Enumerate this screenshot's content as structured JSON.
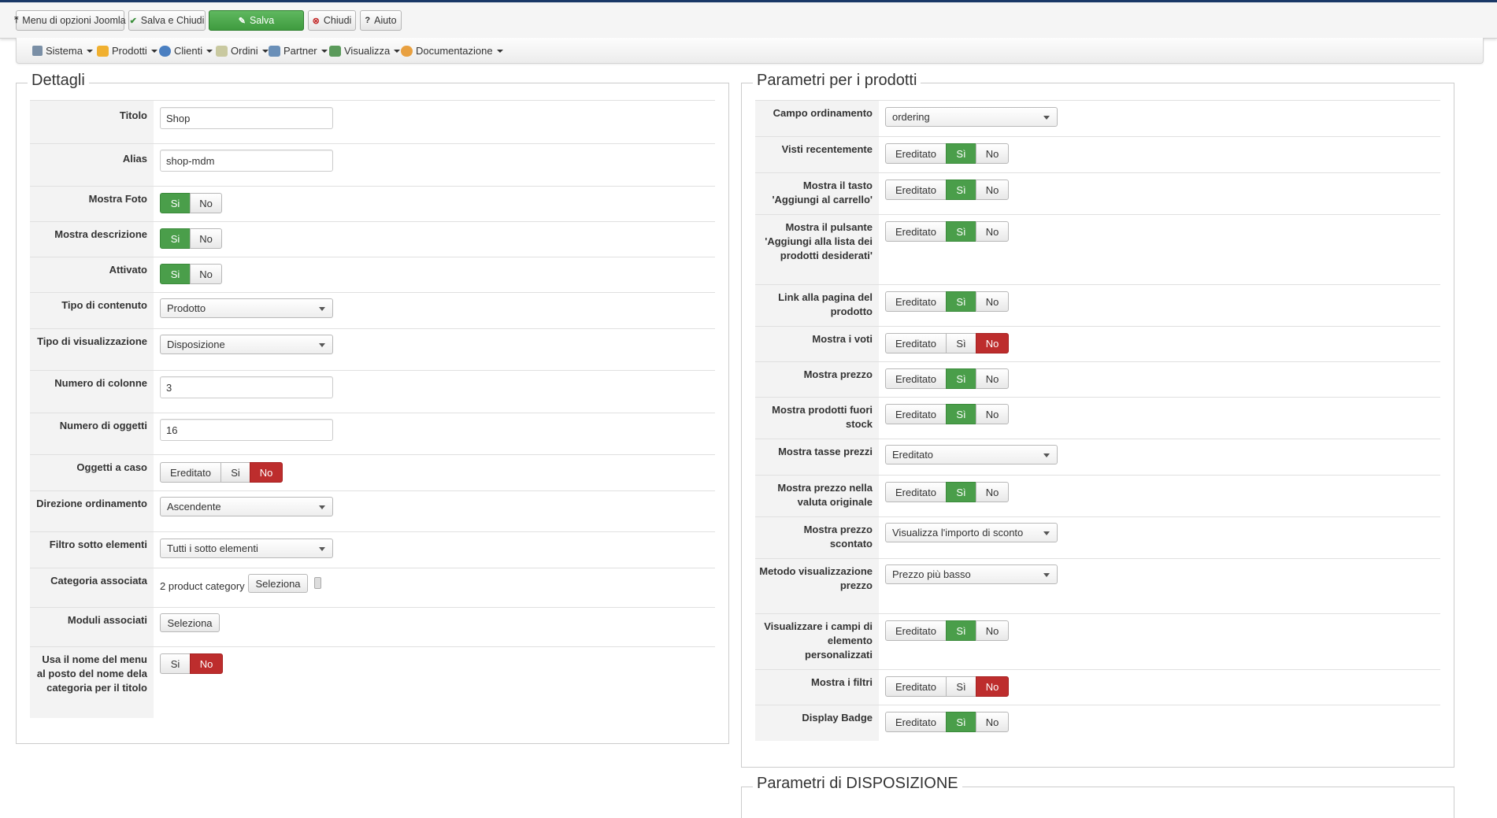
{
  "toolbar": {
    "menu_options": "Menu di opzioni Joomla",
    "save_close": "Salva e Chiudi",
    "save": "Salva",
    "close": "Chiudi",
    "help": "Aiuto"
  },
  "nav": {
    "sistema": "Sistema",
    "prodotti": "Prodotti",
    "clienti": "Clienti",
    "ordini": "Ordini",
    "partner": "Partner",
    "visualizza": "Visualizza",
    "documentazione": "Documentazione"
  },
  "common": {
    "ereditato": "Ereditato",
    "si": "Sì",
    "si_plain": "Si",
    "no": "No"
  },
  "dettagli": {
    "legend": "Dettagli",
    "titolo_label": "Titolo",
    "titolo_value": "Shop",
    "alias_label": "Alias",
    "alias_value": "shop-mdm",
    "mostra_foto_label": "Mostra Foto",
    "mostra_desc_label": "Mostra descrizione",
    "attivato_label": "Attivato",
    "tipo_contenuto_label": "Tipo di contenuto",
    "tipo_contenuto_value": "Prodotto",
    "tipo_vis_label": "Tipo di visualizzazione",
    "tipo_vis_value": "Disposizione",
    "num_colonne_label": "Numero di colonne",
    "num_colonne_value": "3",
    "num_oggetti_label": "Numero di oggetti",
    "num_oggetti_value": "16",
    "oggetti_caso_label": "Oggetti a caso",
    "direzione_label": "Direzione ordinamento",
    "direzione_value": "Ascendente",
    "filtro_label": "Filtro sotto elementi",
    "filtro_value": "Tutti i sotto elementi",
    "categoria_label": "Categoria associata",
    "categoria_value": "2 product category",
    "seleziona": "Seleziona",
    "moduli_label": "Moduli associati",
    "usa_nome_label": "Usa il nome del menu al posto del nome dela categoria per il titolo"
  },
  "parametri": {
    "legend": "Parametri per i prodotti",
    "campo_ord_label": "Campo ordinamento",
    "campo_ord_value": "ordering",
    "visti_label": "Visti recentemente",
    "tasto_carrello_label": "Mostra il tasto 'Aggiungi al carrello'",
    "pulsante_lista_label": "Mostra il pulsante 'Aggiungi alla lista dei prodotti desiderati'",
    "link_pagina_label": "Link alla pagina del prodotto",
    "voti_label": "Mostra i voti",
    "prezzo_label": "Mostra prezzo",
    "fuori_stock_label": "Mostra prodotti fuori stock",
    "tasse_label": "Mostra tasse prezzi",
    "tasse_value": "Ereditato",
    "valuta_label": "Mostra prezzo nella valuta originale",
    "scontato_label": "Mostra prezzo scontato",
    "scontato_value": "Visualizza l'importo di sconto",
    "metodo_label": "Metodo visualizzazione prezzo",
    "metodo_value": "Prezzo più basso",
    "campi_label": "Visualizzare i campi di elemento personalizzati",
    "filtri_label": "Mostra i filtri",
    "badge_label": "Display Badge"
  },
  "disposizione": {
    "legend": "Parametri di DISPOSIZIONE"
  }
}
